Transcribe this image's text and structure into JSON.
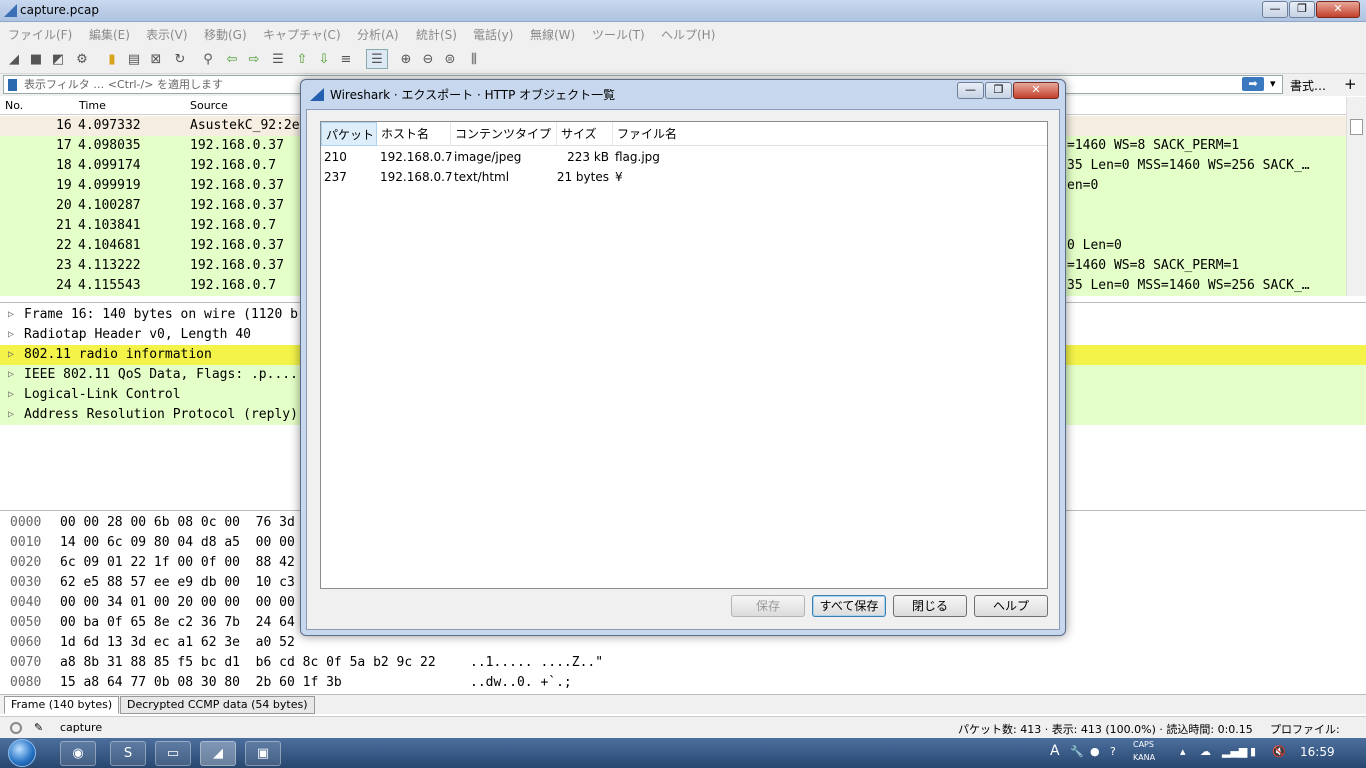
{
  "window": {
    "title": "capture.pcap",
    "min": "—",
    "max": "❐",
    "close": "✕"
  },
  "menu": [
    "ファイル(F)",
    "編集(E)",
    "表示(V)",
    "移動(G)",
    "キャプチャ(C)",
    "分析(A)",
    "統計(S)",
    "電話(y)",
    "無線(W)",
    "ツール(T)",
    "ヘルプ(H)"
  ],
  "filter": {
    "placeholder": "表示フィルタ … <Ctrl-/> を適用します",
    "arrow": "➡",
    "dropdown": "▾",
    "format": "書式…",
    "add": "+"
  },
  "packet_list": {
    "headers": {
      "no": "No.",
      "time": "Time",
      "source": "Source"
    },
    "rows": [
      {
        "no": "16",
        "time": "4.097332",
        "source": "AsustekC_92:2e",
        "tail": ""
      },
      {
        "no": "17",
        "time": "4.098035",
        "source": "192.168.0.37",
        "tail": "=1460 WS=8 SACK_PERM=1"
      },
      {
        "no": "18",
        "time": "4.099174",
        "source": "192.168.0.7",
        "tail": "35 Len=0 MSS=1460 WS=256 SACK_…"
      },
      {
        "no": "19",
        "time": "4.099919",
        "source": "192.168.0.37",
        "tail": "en=0"
      },
      {
        "no": "20",
        "time": "4.100287",
        "source": "192.168.0.37",
        "tail": ""
      },
      {
        "no": "21",
        "time": "4.103841",
        "source": "192.168.0.7",
        "tail": ""
      },
      {
        "no": "22",
        "time": "4.104681",
        "source": "192.168.0.37",
        "tail": "0 Len=0"
      },
      {
        "no": "23",
        "time": "4.113222",
        "source": "192.168.0.37",
        "tail": "=1460 WS=8 SACK_PERM=1"
      },
      {
        "no": "24",
        "time": "4.115543",
        "source": "192.168.0.7",
        "tail": "35 Len=0 MSS=1460 WS=256 SACK_…"
      }
    ]
  },
  "details": [
    "Frame 16: 140 bytes on wire (1120 b",
    "Radiotap Header v0, Length 40",
    "802.11 radio information",
    "IEEE 802.11 QoS Data, Flags: .p....",
    "Logical-Link Control",
    "Address Resolution Protocol (reply)"
  ],
  "bytes": [
    {
      "off": "0000",
      "hex": "00 00 28 00 6b 08 0c 00  76 3d",
      "ascii": ""
    },
    {
      "off": "0010",
      "hex": "14 00 6c 09 80 04 d8 a5  00 00",
      "ascii": ""
    },
    {
      "off": "0020",
      "hex": "6c 09 01 22 1f 00 0f 00  88 42",
      "ascii": ""
    },
    {
      "off": "0030",
      "hex": "62 e5 88 57 ee e9 db 00  10 c3",
      "ascii": ""
    },
    {
      "off": "0040",
      "hex": "00 00 34 01 00 20 00 00  00 00",
      "ascii": ""
    },
    {
      "off": "0050",
      "hex": "00 ba 0f 65 8e c2 36 7b  24 64",
      "ascii": ""
    },
    {
      "off": "0060",
      "hex": "1d 6d 13 3d ec a1 62 3e  a0 52",
      "ascii": ""
    },
    {
      "off": "0070",
      "hex": "a8 8b 31 88 85 f5 bc d1  b6 cd 8c 0f 5a b2 9c 22",
      "ascii": "..1..... ....Z..\""
    },
    {
      "off": "0080",
      "hex": "15 a8 64 77 0b 08 30 80  2b 60 1f 3b",
      "ascii": "..dw..0. +`.;"
    }
  ],
  "byte_tabs": [
    "Frame (140 bytes)",
    "Decrypted CCMP data (54 bytes)"
  ],
  "status": {
    "profile_name": "capture",
    "packets": "パケット数: 413 · 表示: 413 (100.0%) · 読込時間: 0:0.15",
    "profile": "プロファイル: Default"
  },
  "dialog": {
    "title": "Wireshark · エクスポート · HTTP オブジェクト一覧",
    "columns": [
      "パケット",
      "ホスト名",
      "コンテンツタイプ",
      "サイズ",
      "ファイル名"
    ],
    "rows": [
      {
        "packet": "210",
        "host": "192.168.0.7",
        "type": "image/jpeg",
        "size": "223 kB",
        "file": "flag.jpg"
      },
      {
        "packet": "237",
        "host": "192.168.0.7",
        "type": "text/html",
        "size": "21 bytes",
        "file": "¥"
      }
    ],
    "buttons": {
      "save": "保存",
      "save_all": "すべて保存",
      "close": "閉じる",
      "help": "ヘルプ"
    },
    "win_min": "—",
    "win_max": "❐",
    "win_close": "✕"
  },
  "taskbar": {
    "clock": "16:59",
    "tray_a": "A",
    "tray_caps": "CAPS",
    "tray_kana": "KANA"
  },
  "colors": {
    "tcp_row": "#e4ffc7",
    "selected_row": "#f5eee1",
    "highlight_detail": "#f3f34a",
    "accent": "#3a78c0"
  }
}
